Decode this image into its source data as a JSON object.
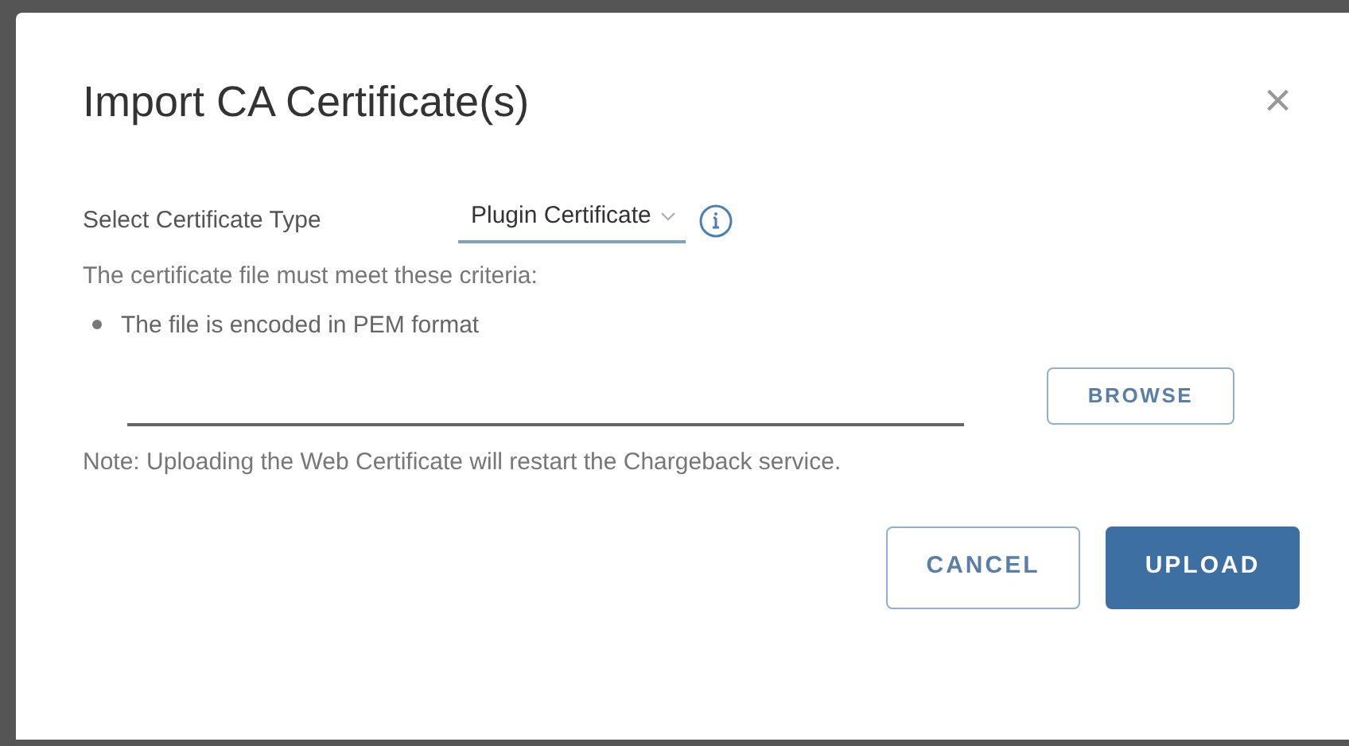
{
  "dialog": {
    "title": "Import CA Certificate(s)",
    "close": "×"
  },
  "certificate_type": {
    "label": "Select Certificate Type",
    "value": "Plugin Certificate"
  },
  "criteria": {
    "intro": "The certificate file must meet these criteria:",
    "items": [
      "The file is encoded in PEM format"
    ]
  },
  "file_field": {
    "browse": "BROWSE"
  },
  "note": "Note: Uploading the Web Certificate will restart the Chargeback service.",
  "buttons": [
    {
      "label": "CANCEL",
      "kind": "secondary"
    },
    {
      "label": "UPLOAD",
      "kind": "primary"
    }
  ]
}
